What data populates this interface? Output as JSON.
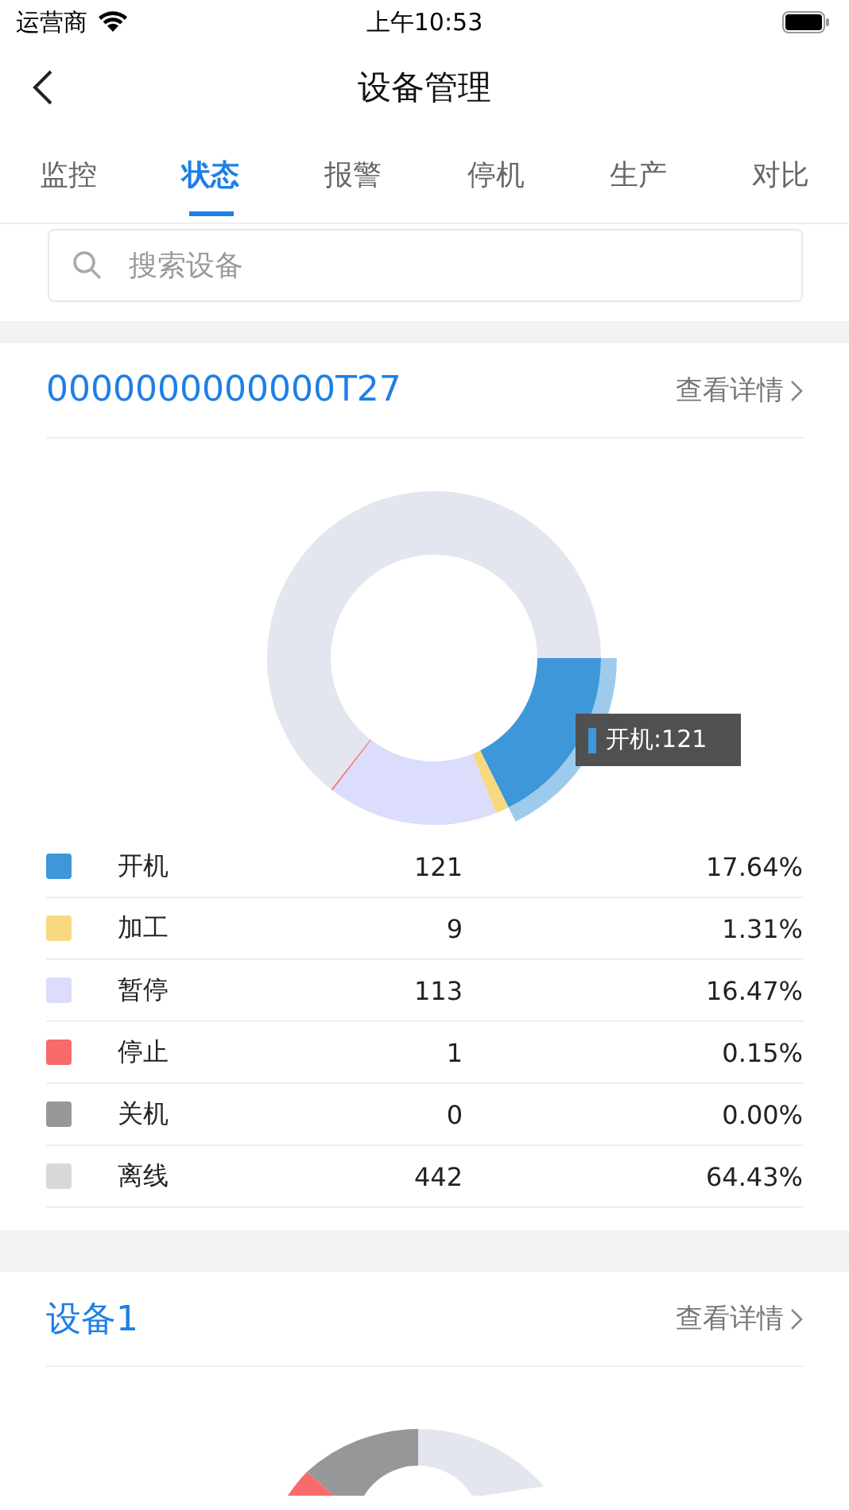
{
  "status_bar": {
    "carrier": "运营商",
    "time": "上午10:53"
  },
  "nav": {
    "title": "设备管理"
  },
  "tabs": [
    {
      "label": "监控",
      "selected": false
    },
    {
      "label": "状态",
      "selected": true
    },
    {
      "label": "报警",
      "selected": false
    },
    {
      "label": "停机",
      "selected": false
    },
    {
      "label": "生产",
      "selected": false
    },
    {
      "label": "对比",
      "selected": false
    }
  ],
  "search": {
    "placeholder": "搜索设备"
  },
  "devices": [
    {
      "name": "0000000000000T27",
      "detail_link": "查看详情",
      "chart_data": {
        "type": "donut",
        "categories": [
          "开机",
          "加工",
          "暂停",
          "停止",
          "关机",
          "离线"
        ],
        "values": [
          17.64,
          1.31,
          16.47,
          0.15,
          0,
          64.43
        ]
      },
      "tooltip": {
        "label": "开机:121"
      },
      "legend": [
        {
          "color": "#3e97d8",
          "count": "121",
          "percent": "17.64%",
          "highlighted": true
        },
        {
          "color": "#f8d97f",
          "count": "9",
          "percent": "1.31%",
          "highlighted": false
        },
        {
          "color": "#dcdcfc",
          "count": "113",
          "percent": "16.47%",
          "highlighted": false
        },
        {
          "color": "#f96a6a",
          "count": "1",
          "percent": "0.15%",
          "highlighted": false
        },
        {
          "color": "#979797",
          "count": "0",
          "percent": "0.00%",
          "highlighted": false
        },
        {
          "color": "#d8d8d8",
          "count": "442",
          "percent": "64.43%",
          "highlighted": false
        }
      ]
    },
    {
      "name": "设备1",
      "detail_link": "查看详情"
    }
  ]
}
